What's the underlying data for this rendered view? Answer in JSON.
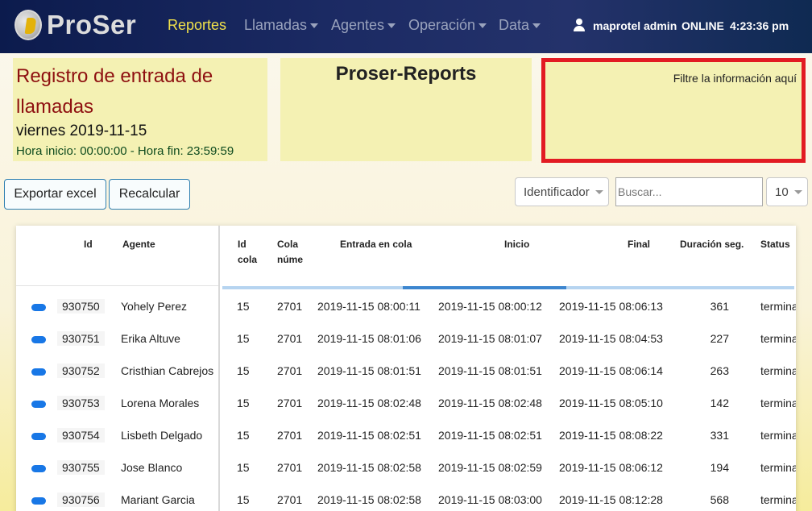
{
  "nav": {
    "brand": "ProSer",
    "items": [
      {
        "label": "Reportes",
        "active": true,
        "dropdown": false
      },
      {
        "label": "Llamadas",
        "active": false,
        "dropdown": true
      },
      {
        "label": "Agentes",
        "active": false,
        "dropdown": true
      },
      {
        "label": "Operación",
        "active": false,
        "dropdown": true
      },
      {
        "label": "Data",
        "active": false,
        "dropdown": true
      }
    ],
    "user": "maprotel admin",
    "status": "ONLINE",
    "time": "4:23:36 pm"
  },
  "report": {
    "title": "Registro de entrada de llamadas",
    "date": "viernes 2019-11-15",
    "hours": "Hora inicio: 00:00:00 - Hora fin: 23:59:59",
    "app_title": "Proser-Reports",
    "filter_hint": "Filtre la información aquí"
  },
  "toolbar": {
    "export_label": "Exportar excel",
    "recalc_label": "Recalcular",
    "field_select": "Identificador",
    "search_placeholder": "Buscar...",
    "page_size": "10"
  },
  "table": {
    "headers": {
      "id": "Id",
      "agent": "Agente",
      "queue_id_1": "Id",
      "queue_id_2": "cola",
      "queue_num_1": "Cola",
      "queue_num_2": "núme",
      "entry": "Entrada en cola",
      "start": "Inicio",
      "end": "Final",
      "duration": "Duración seg.",
      "status": "Status"
    },
    "rows": [
      {
        "id": "930750",
        "agent": "Yohely Perez",
        "queue_id": "15",
        "queue_num": "2701",
        "entry": "2019-11-15 08:00:11",
        "start": "2019-11-15 08:00:12",
        "end": "2019-11-15 08:06:13",
        "duration": "361",
        "status": "termina"
      },
      {
        "id": "930751",
        "agent": "Erika Altuve",
        "queue_id": "15",
        "queue_num": "2701",
        "entry": "2019-11-15 08:01:06",
        "start": "2019-11-15 08:01:07",
        "end": "2019-11-15 08:04:53",
        "duration": "227",
        "status": "termina"
      },
      {
        "id": "930752",
        "agent": "Cristhian Cabrejos",
        "queue_id": "15",
        "queue_num": "2701",
        "entry": "2019-11-15 08:01:51",
        "start": "2019-11-15 08:01:51",
        "end": "2019-11-15 08:06:14",
        "duration": "263",
        "status": "termina"
      },
      {
        "id": "930753",
        "agent": "Lorena Morales",
        "queue_id": "15",
        "queue_num": "2701",
        "entry": "2019-11-15 08:02:48",
        "start": "2019-11-15 08:02:48",
        "end": "2019-11-15 08:05:10",
        "duration": "142",
        "status": "termina"
      },
      {
        "id": "930754",
        "agent": "Lisbeth Delgado",
        "queue_id": "15",
        "queue_num": "2701",
        "entry": "2019-11-15 08:02:51",
        "start": "2019-11-15 08:02:51",
        "end": "2019-11-15 08:08:22",
        "duration": "331",
        "status": "termina"
      },
      {
        "id": "930755",
        "agent": "Jose Blanco",
        "queue_id": "15",
        "queue_num": "2701",
        "entry": "2019-11-15 08:02:58",
        "start": "2019-11-15 08:02:59",
        "end": "2019-11-15 08:06:12",
        "duration": "194",
        "status": "termina"
      },
      {
        "id": "930756",
        "agent": "Mariant Garcia",
        "queue_id": "15",
        "queue_num": "2701",
        "entry": "2019-11-15 08:02:58",
        "start": "2019-11-15 08:03:00",
        "end": "2019-11-15 08:12:28",
        "duration": "568",
        "status": "termina"
      }
    ]
  },
  "colors": {
    "accent": "#f2e24a",
    "filter_border": "#e21b23",
    "row_marker": "#1877e6"
  }
}
